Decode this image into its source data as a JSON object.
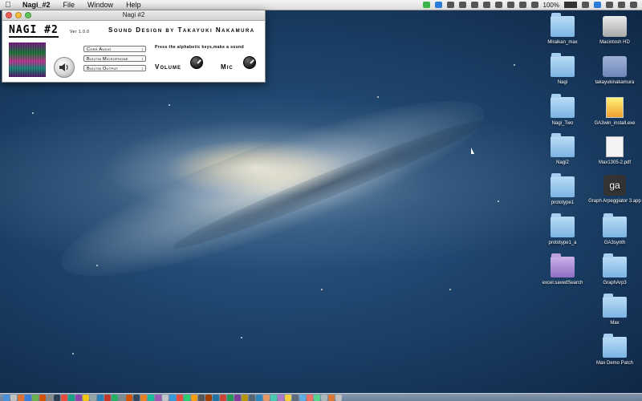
{
  "menubar": {
    "app_name": "Nagi_#2",
    "menus": [
      "File",
      "Window",
      "Help"
    ],
    "battery": "100%"
  },
  "window": {
    "title": "Nagi #2",
    "app_title": "NAGI #2",
    "version": "Ver 1.0.0",
    "credit": "Sound Design by Takayuki Nakamura",
    "hint": "Press the alphabetic keys,make a sound",
    "selects": {
      "driver": "Core Audio",
      "input": "Builtin Microphone",
      "output": "Builtin Output"
    },
    "volume_label": "Volume",
    "mic_label": "Mic"
  },
  "desktop": {
    "icons": [
      {
        "label": "Miraikan_max",
        "kind": "folder"
      },
      {
        "label": "Macintosh HD",
        "kind": "hd"
      },
      {
        "label": "Nagi",
        "kind": "folder"
      },
      {
        "label": "takayukinakamura",
        "kind": "users"
      },
      {
        "label": "Nagi_Two",
        "kind": "folder"
      },
      {
        "label": "GA3win_install.exe",
        "kind": "exe"
      },
      {
        "label": "Nagi2",
        "kind": "folder"
      },
      {
        "label": "Max1305-2.pdf",
        "kind": "doc"
      },
      {
        "label": "prototype1",
        "kind": "folder"
      },
      {
        "label": "Graph Arpeggiator 3.app",
        "kind": "app"
      },
      {
        "label": "prototype1_a",
        "kind": "folder"
      },
      {
        "label": "GA3synth",
        "kind": "folder"
      },
      {
        "label": "excel.savedSearch",
        "kind": "folder-purple"
      },
      {
        "label": "GraphArp3",
        "kind": "folder"
      },
      {
        "label": "Max",
        "kind": "folder"
      },
      {
        "label": "Max Demo Patch",
        "kind": "folder"
      }
    ]
  },
  "app_icon_text": "ga"
}
